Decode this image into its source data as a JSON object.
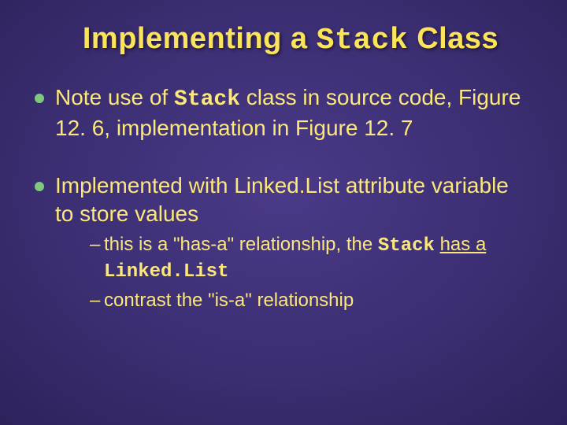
{
  "title": {
    "pre": "Implementing a ",
    "code": "Stack",
    "post": " Class"
  },
  "b1": {
    "pre": "Note use of ",
    "code": "Stack",
    "post1": " class in source code, Figure 12. 6, implementation in Figure 12. 7"
  },
  "b2": {
    "text": "Implemented with Linked.List attribute variable to store values"
  },
  "b2a": {
    "pre": "this is a \"has-a\" relationship, the ",
    "code1": "Stack",
    "mid_ul": "has a",
    "code2": "Linked.List"
  },
  "b2b": {
    "text": "contrast the \"is-a\" relationship"
  }
}
